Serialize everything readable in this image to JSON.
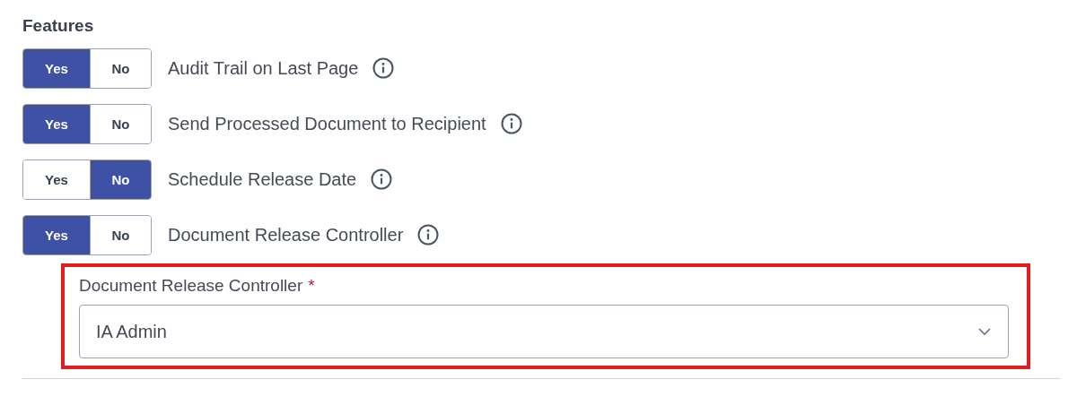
{
  "section_title": "Features",
  "features": [
    {
      "label": "Audit Trail on Last Page",
      "options": [
        {
          "label": "Yes",
          "selected": true
        },
        {
          "label": "No",
          "selected": false
        }
      ]
    },
    {
      "label": "Send Processed Document to Recipient",
      "options": [
        {
          "label": "Yes",
          "selected": true
        },
        {
          "label": "No",
          "selected": false
        }
      ]
    },
    {
      "label": "Schedule Release Date",
      "options": [
        {
          "label": "Yes",
          "selected": false
        },
        {
          "label": "No",
          "selected": true
        }
      ]
    },
    {
      "label": "Document Release Controller",
      "options": [
        {
          "label": "Yes",
          "selected": true
        },
        {
          "label": "No",
          "selected": false
        }
      ]
    }
  ],
  "controller_field": {
    "label": "Document Release Controller",
    "required_mark": "*",
    "value": "IA Admin"
  }
}
